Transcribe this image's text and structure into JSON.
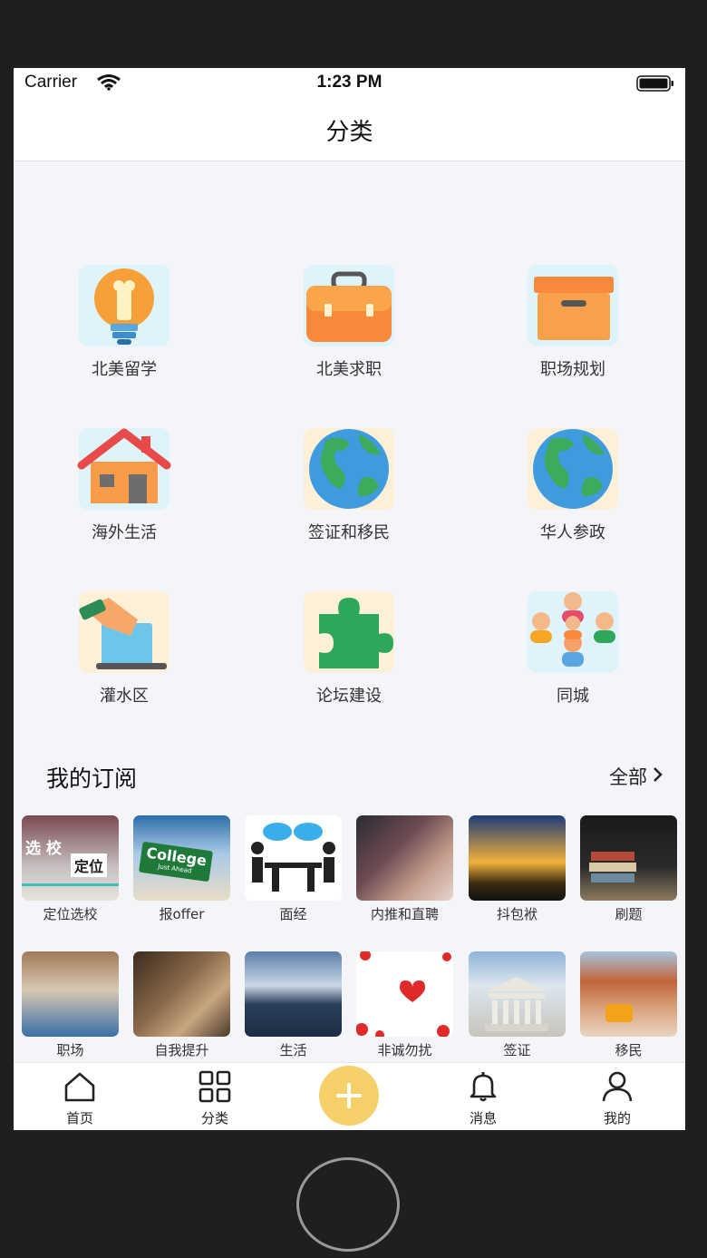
{
  "status": {
    "carrier": "Carrier",
    "time": "1:23 PM"
  },
  "nav": {
    "title": "分类"
  },
  "categories": [
    {
      "label": "北美留学",
      "icon": "lightbulb-icon"
    },
    {
      "label": "北美求职",
      "icon": "briefcase-icon"
    },
    {
      "label": "职场规划",
      "icon": "archive-box-icon"
    },
    {
      "label": "海外生活",
      "icon": "house-icon"
    },
    {
      "label": "签证和移民",
      "icon": "globe-icon"
    },
    {
      "label": "华人参政",
      "icon": "globe-icon"
    },
    {
      "label": "灌水区",
      "icon": "ballot-box-icon"
    },
    {
      "label": "论坛建设",
      "icon": "puzzle-icon"
    },
    {
      "label": "同城",
      "icon": "people-group-icon"
    }
  ],
  "subscriptions": {
    "title": "我的订阅",
    "all_label": "全部",
    "items": [
      {
        "label": "定位选校",
        "overlay": [
          "选 校",
          "定位"
        ]
      },
      {
        "label": "报offer",
        "overlay": [
          "College",
          "Just Ahead"
        ]
      },
      {
        "label": "面经"
      },
      {
        "label": "内推和直聘"
      },
      {
        "label": "抖包袱"
      },
      {
        "label": "刷题"
      },
      {
        "label": "职场"
      },
      {
        "label": "自我提升"
      },
      {
        "label": "生活"
      },
      {
        "label": "非诚勿扰"
      },
      {
        "label": "签证"
      },
      {
        "label": "移民"
      }
    ]
  },
  "tabs": [
    {
      "label": "首页",
      "icon": "home-icon"
    },
    {
      "label": "分类",
      "icon": "grid-icon"
    },
    {
      "label": "",
      "icon": "plus-icon"
    },
    {
      "label": "消息",
      "icon": "bell-icon"
    },
    {
      "label": "我的",
      "icon": "user-icon"
    }
  ],
  "colors": {
    "accent": "#f5cf6a",
    "background": "#f4f5f9"
  }
}
